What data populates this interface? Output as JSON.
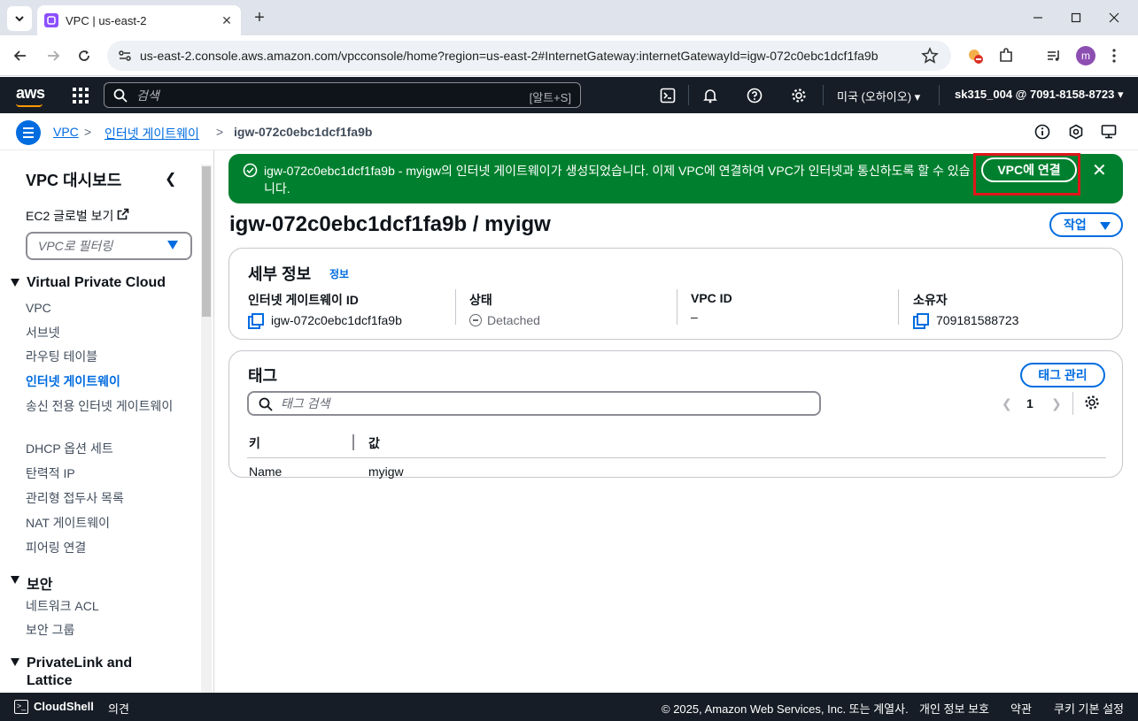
{
  "browser": {
    "tab_title": "VPC | us-east-2",
    "url": "us-east-2.console.aws.amazon.com/vpcconsole/home?region=us-east-2#InternetGateway:internetGatewayId=igw-072c0ebc1dcf1fa9b",
    "avatar_letter": "m"
  },
  "aws_header": {
    "logo": "aws",
    "search_placeholder": "검색",
    "search_shortcut": "[알트+S]",
    "region": "미국 (오하이오)",
    "account": "sk315_004 @ 7091-8158-8723"
  },
  "breadcrumb": {
    "items": [
      "VPC",
      "인터넷 게이트웨이"
    ],
    "current": "igw-072c0ebc1dcf1fa9b",
    "separator": ">"
  },
  "sidebar": {
    "title": "VPC 대시보드",
    "ec2_global": "EC2 글로벌 보기",
    "filter_placeholder": "VPC로 필터링",
    "sections": [
      {
        "label": "Virtual Private Cloud",
        "items": [
          "VPC",
          "서브넷",
          "라우팅 테이블",
          "인터넷 게이트웨이",
          "송신 전용 인터넷 게이트웨이",
          "DHCP 옵션 세트",
          "탄력적 IP",
          "관리형 접두사 목록",
          "NAT 게이트웨이",
          "피어링 연결"
        ]
      },
      {
        "label": "보안",
        "items": [
          "네트워크 ACL",
          "보안 그룹"
        ]
      },
      {
        "label": "PrivateLink and Lattice",
        "items": []
      }
    ],
    "active_item": "인터넷 게이트웨이"
  },
  "flash": {
    "message": "igw-072c0ebc1dcf1fa9b - myigw의 인터넷 게이트웨이가 생성되었습니다. 이제 VPC에 연결하여 VPC가 인터넷과 통신하도록 할 수 있습니다.",
    "button": "VPC에 연결",
    "color": "#00802f"
  },
  "page": {
    "title": "igw-072c0ebc1dcf1fa9b / myigw",
    "actions_label": "작업"
  },
  "details": {
    "title": "세부 정보",
    "info": "정보",
    "columns": [
      {
        "label": "인터넷 게이트웨이 ID",
        "value": "igw-072c0ebc1dcf1fa9b"
      },
      {
        "label": "상태",
        "value": "Detached"
      },
      {
        "label": "VPC ID",
        "value": "–"
      },
      {
        "label": "소유자",
        "value": "709181588723"
      }
    ]
  },
  "tags": {
    "title": "태그",
    "manage_label": "태그 관리",
    "search_placeholder": "태그 검색",
    "page": "1",
    "headers": [
      "키",
      "값"
    ],
    "rows": [
      {
        "key": "Name",
        "value": "myigw"
      }
    ]
  },
  "footer": {
    "cloudshell": "CloudShell",
    "feedback": "의견",
    "copyright": "© 2025, Amazon Web Services, Inc. 또는 계열사.",
    "privacy": "개인 정보 보호",
    "terms": "약관",
    "cookies": "쿠키 기본 설정"
  }
}
